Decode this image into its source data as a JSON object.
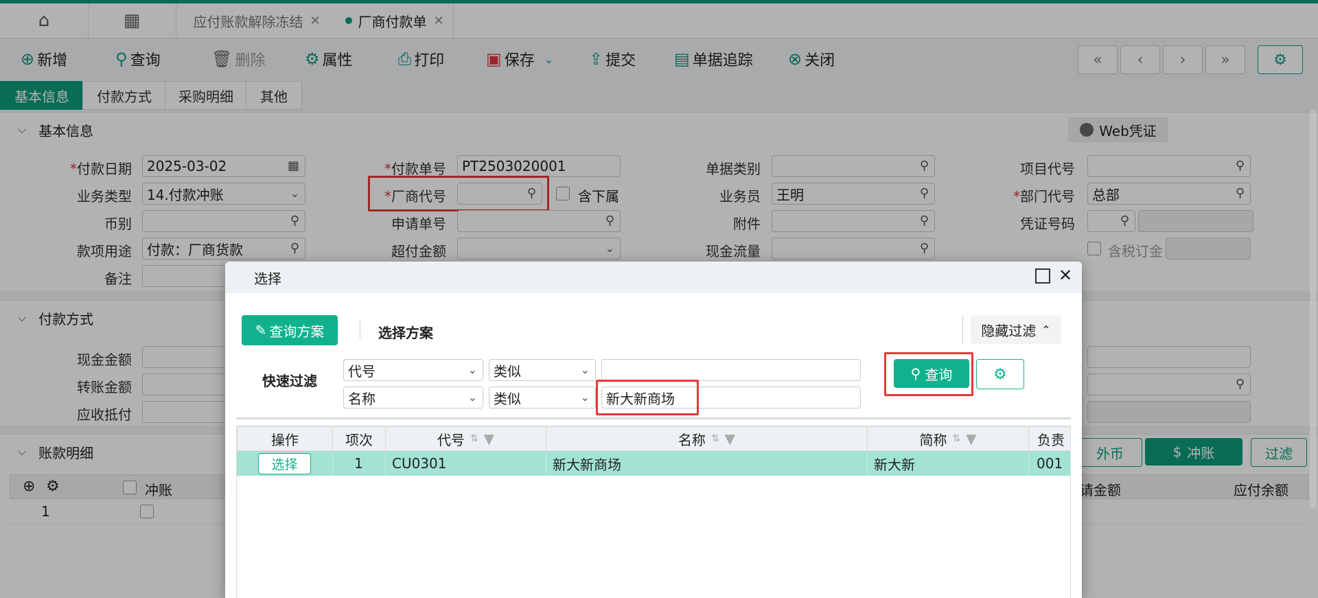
{
  "tabs": {
    "tab1": "应付账款解除冻结",
    "tab2": "厂商付款单"
  },
  "toolbar": {
    "add": "新增",
    "query": "查询",
    "delete": "删除",
    "properties": "属性",
    "print": "打印",
    "save": "保存",
    "submit": "提交",
    "trace": "单据追踪",
    "close": "关闭"
  },
  "subtabs": [
    "基本信息",
    "付款方式",
    "采购明细",
    "其他"
  ],
  "sections": {
    "basic": "基本信息",
    "payment": "付款方式",
    "detail": "账款明细",
    "web_voucher": "Web凭证"
  },
  "form": {
    "pay_date_label": "付款日期",
    "pay_date": "2025-03-02",
    "biz_type_label": "业务类型",
    "biz_type": "14.付款冲账",
    "currency_label": "币别",
    "usage_label": "款项用途",
    "usage": "付款：厂商货款",
    "remark_label": "备注",
    "pay_no_label": "付款单号",
    "pay_no": "PT2503020001",
    "vendor_label": "厂商代号",
    "include_sub": "含下属",
    "apply_no_label": "申请单号",
    "overpay_label": "超付金额",
    "doc_type_label": "单据类别",
    "staff_label": "业务员",
    "staff": "王明",
    "attach_label": "附件",
    "cashflow_label": "现金流量",
    "project_label": "项目代号",
    "dept_label": "部门代号",
    "dept": "总部",
    "voucher_label": "凭证号码",
    "tax_order": "含税订金",
    "cash_amt_label": "现金金额",
    "transfer_amt_label": "转账金额",
    "recv_offset_label": "应收抵付"
  },
  "detail": {
    "offset_col": "冲账",
    "row1": "1",
    "apply_amt": "请金额",
    "payable_balance": "应付余额",
    "foreign": "外币",
    "offset_btn": "冲账",
    "filter_btn": "过滤"
  },
  "dialog": {
    "title": "选择",
    "query_plan": "查询方案",
    "select_plan": "选择方案",
    "hide_filter": "隐藏过滤",
    "quick_filter": "快速过滤",
    "filter1_field": "代号",
    "filter1_op": "类似",
    "filter1_value": "",
    "filter2_field": "名称",
    "filter2_op": "类似",
    "filter2_value": "新大新商场",
    "query_btn": "查询",
    "columns": [
      "操作",
      "项次",
      "代号",
      "名称",
      "简称",
      "负责"
    ],
    "row": {
      "action": "选择",
      "index": "1",
      "code": "CU0301",
      "name": "新大新商场",
      "short": "新大新",
      "owner": "001"
    }
  }
}
